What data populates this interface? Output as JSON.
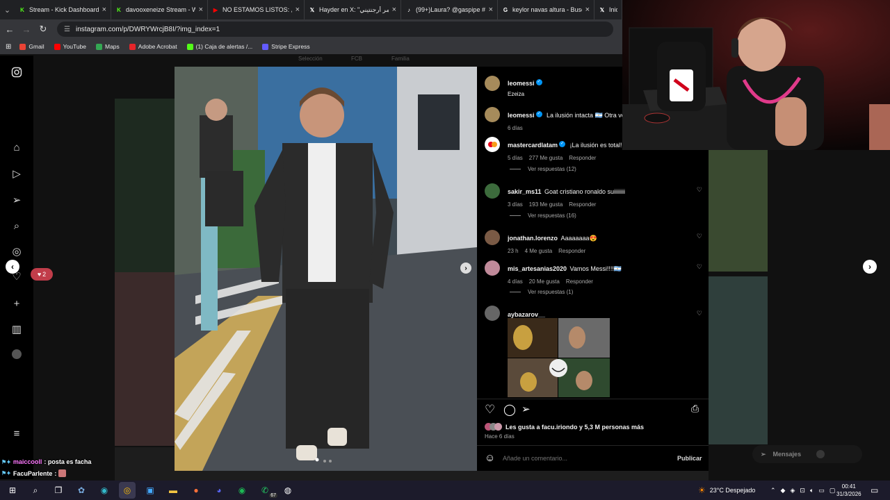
{
  "browser": {
    "tabs": [
      {
        "label": "Stream - Kick Dashboard",
        "icon": "kick-icon",
        "color": "#53fc18"
      },
      {
        "label": "davooxeneize Stream - W",
        "icon": "kick-icon",
        "color": "#53fc18"
      },
      {
        "label": "NO ESTAMOS LISTOS: ¿Pu",
        "icon": "youtube-icon",
        "color": "#ff0000"
      },
      {
        "label": "Hayder en X: \"عمر أرجنتيني",
        "icon": "x-icon",
        "color": "#ffffff"
      },
      {
        "label": "(99+)Laura? @gaspipe #",
        "icon": "tiktok-icon",
        "color": "#ffffff"
      },
      {
        "label": "keylor navas altura - Busc",
        "icon": "google-icon",
        "color": "#ffffff"
      },
      {
        "label": "Inici",
        "icon": "x-icon",
        "color": "#ffffff"
      }
    ],
    "url": "instagram.com/p/DWRYWrcjB8I/?img_index=1",
    "bookmarks": [
      {
        "label": "Gmail",
        "color": "#ea4335"
      },
      {
        "label": "YouTube",
        "color": "#ff0000"
      },
      {
        "label": "Maps",
        "color": "#34a853"
      },
      {
        "label": "Adobe Acrobat",
        "color": "#e5252a"
      },
      {
        "label": "(1) Caja de alertas /...",
        "color": "#53fc18"
      },
      {
        "label": "Stripe Express",
        "color": "#635bff"
      }
    ]
  },
  "background": {
    "faint_tabs": [
      "Selección",
      "FCB",
      "Familia"
    ],
    "likes_badge": "2",
    "messages_label": "Mensajes"
  },
  "post": {
    "author": {
      "username": "leomessi",
      "location": "Ezeiza"
    },
    "caption": {
      "username": "leomessi",
      "text": "La ilusión intacta 🇦🇷 Otra vez",
      "age": "6 días"
    },
    "comments": [
      {
        "username": "mastercardlatam",
        "verified": true,
        "text": "¡La ilusión es total!",
        "age": "5 días",
        "likes": "277 Me gusta",
        "reply": "Responder",
        "replies": "Ver respuestas (12)",
        "avatar_color": "#ffffff"
      },
      {
        "username": "sakir_ms11",
        "text": "Goat cristiano ronaldo suiiiiiiii",
        "age": "3 días",
        "likes": "193 Me gusta",
        "reply": "Responder",
        "replies": "Ver respuestas (16)",
        "avatar_color": "#3c6b3c"
      },
      {
        "username": "jonathan.lorenzo",
        "text": "Aaaaaaaa😍",
        "age": "23 h",
        "likes": "4 Me gusta",
        "reply": "Responder",
        "avatar_color": "#7a5a45"
      },
      {
        "username": "mis_artesanias2020",
        "text": "Vamos Messi!!!!🇦🇷",
        "age": "4 días",
        "likes": "20 Me gusta",
        "reply": "Responder",
        "replies": "Ver respuestas (1)",
        "avatar_color": "#c08a9a"
      },
      {
        "username": "aybazarov__",
        "text": "",
        "avatar_color": "#666666"
      }
    ],
    "likes_summary": "Les gusta a facu.iriondo y 5,3 M personas más",
    "posted": "Hace 6 días",
    "comment_placeholder": "Añade un comentario...",
    "publish_label": "Publicar"
  },
  "chat": [
    {
      "user": "maiccooll",
      "message": ": posta es facha",
      "color": "#ff77ff"
    },
    {
      "user": "FacuParlente",
      "message": ":",
      "color": "#ffffff"
    }
  ],
  "taskbar": {
    "whatsapp_badge": "67",
    "weather": "23°C  Despejado",
    "time": "00:41",
    "date": "31/3/2026"
  }
}
